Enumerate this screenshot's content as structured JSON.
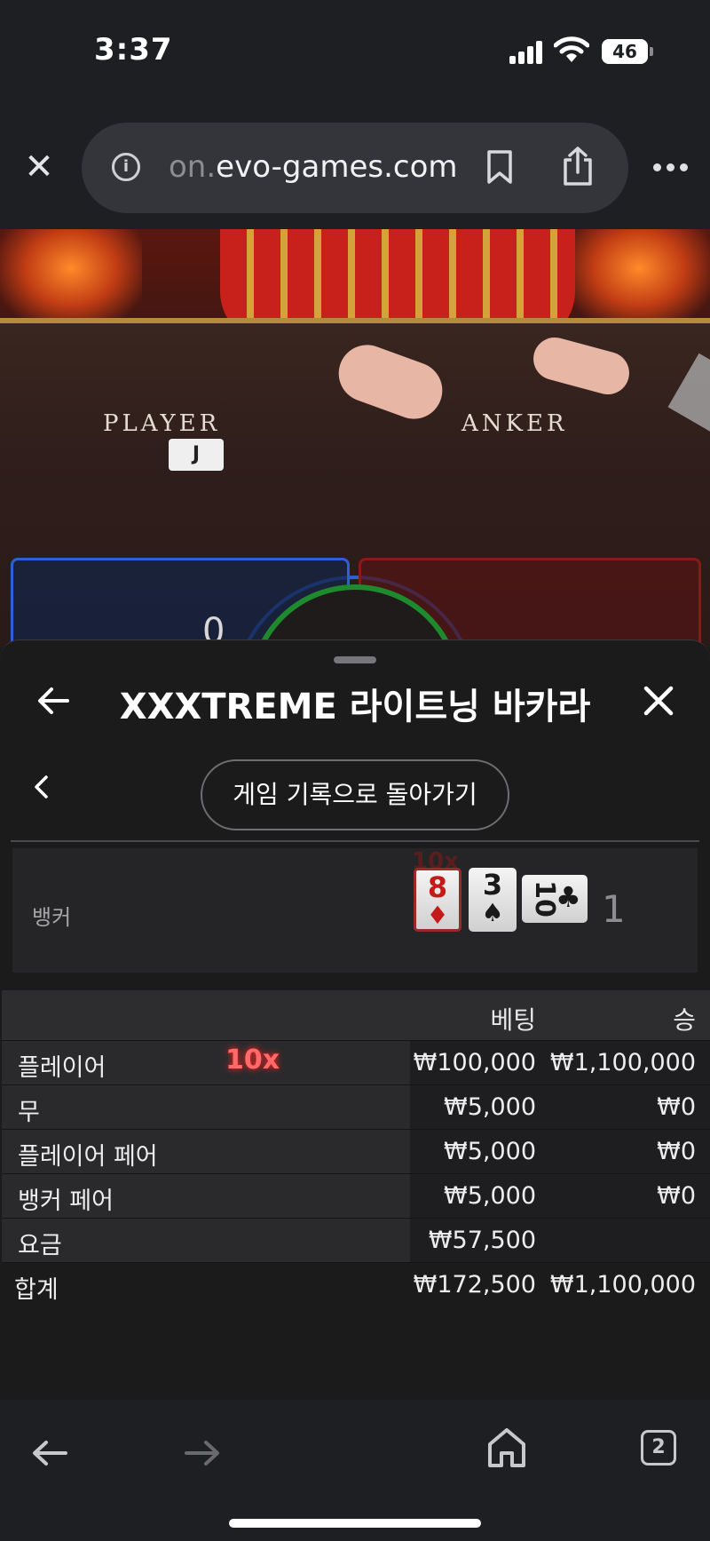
{
  "status": {
    "time": "3:37",
    "battery": "46"
  },
  "browser": {
    "url_faded": "on.",
    "url_main": "evo-games.com",
    "tab_count": "2"
  },
  "video": {
    "player_label": "PLAYER",
    "banker_label": "ANKER",
    "table_card": "J",
    "bet_zero": "0"
  },
  "sheet": {
    "title": "XXXTREME 라이트닝 바카라",
    "history_button": "게임 기록으로 돌아가기",
    "result": {
      "label": "뱅커",
      "multiplier": "10x",
      "cards": [
        {
          "rank": "8",
          "suit": "♦",
          "color": "#c41a1a"
        },
        {
          "rank": "3",
          "suit": "♠",
          "color": "#1a1a1a"
        },
        {
          "rank": "10",
          "suit": "♣",
          "color": "#1a1a1a"
        }
      ],
      "score": "1"
    },
    "table": {
      "col_bet": "베팅",
      "col_win": "승",
      "rows": [
        {
          "name": "플레이어",
          "multiplier": "10x",
          "bet": "₩100,000",
          "win": "₩1,100,000"
        },
        {
          "name": "무",
          "bet": "₩5,000",
          "win": "₩0"
        },
        {
          "name": "플레이어 페어",
          "bet": "₩5,000",
          "win": "₩0"
        },
        {
          "name": "뱅커 페어",
          "bet": "₩5,000",
          "win": "₩0"
        },
        {
          "name": "요금",
          "bet": "₩57,500",
          "win": ""
        }
      ],
      "total": {
        "name": "합계",
        "bet": "₩172,500",
        "win": "₩1,100,000"
      }
    }
  },
  "colors": {
    "player_blue": "#2e5fd8",
    "banker_red": "#8a1a18",
    "tie_green": "#1e8a2e",
    "multiplier_red": "#ff6a6a"
  }
}
